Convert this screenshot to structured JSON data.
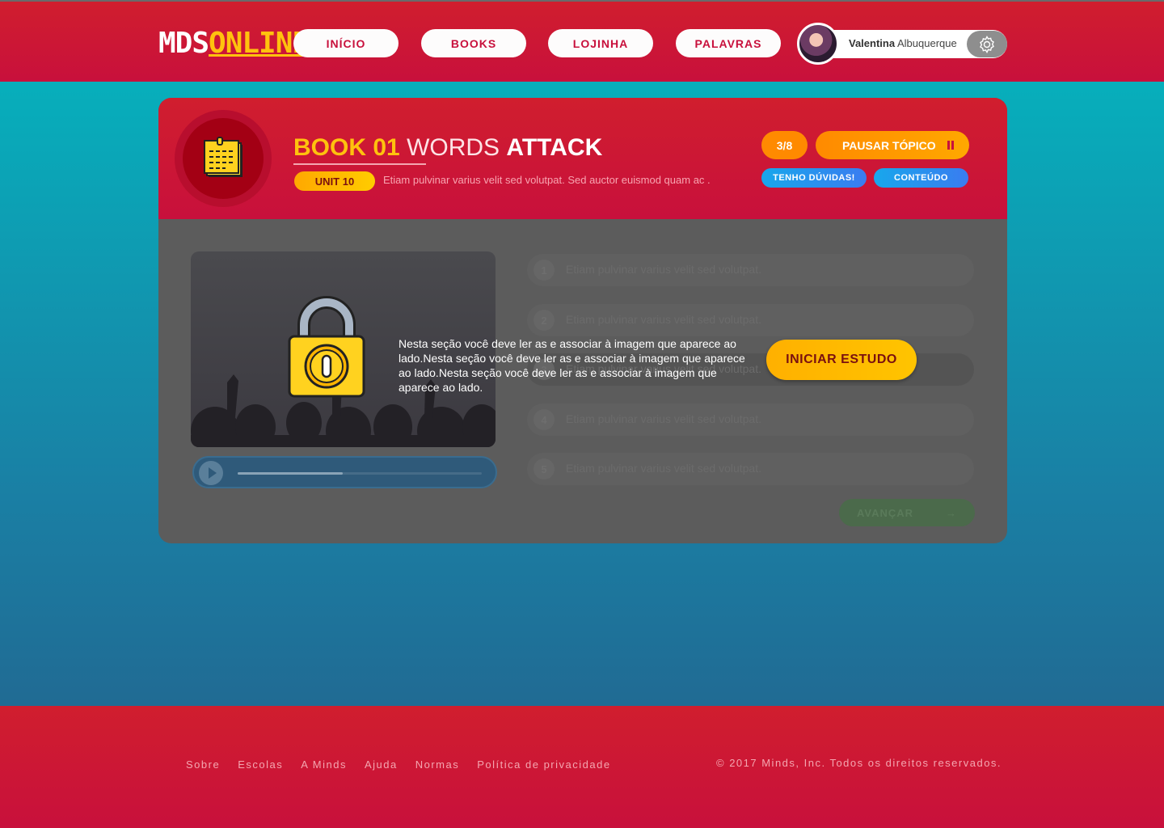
{
  "header": {
    "logo_part1": "MDS",
    "logo_part2": "ONLINE",
    "nav": [
      "INÍCIO",
      "BOOKS",
      "LOJINHA",
      "PALAVRAS"
    ],
    "user_first": "Valentina",
    "user_last": "Albuquerque"
  },
  "topic": {
    "book": "BOOK 01",
    "title_part1": "WORDS",
    "title_part2": "ATTACK",
    "unit": "UNIT 10",
    "unit_description": "Etiam pulvinar varius velit sed volutpat. Sed auctor euismod quam ac .",
    "progress": "3/8",
    "pause_label": "PAUSAR TÓPICO",
    "doubts_label": "TENHO DÚVIDAS!",
    "content_label": "CONTEÚDO"
  },
  "player": {
    "progress_fraction": 0.43
  },
  "questions": [
    {
      "number": "1",
      "text": "Etiam pulvinar varius velit sed volutpat."
    },
    {
      "number": "2",
      "text": "Etiam pulvinar varius velit sed volutpat."
    },
    {
      "number": "3",
      "text": "Etiam pulvinar varius velit sed volutpat."
    },
    {
      "number": "4",
      "text": "Etiam pulvinar varius velit sed volutpat."
    },
    {
      "number": "5",
      "text": "Etiam pulvinar varius velit sed volutpat."
    }
  ],
  "advance_label": "AVANÇAR",
  "advance_arrow": "→",
  "overlay": {
    "message": "Nesta seção você deve ler as   e associar à imagem que aparece ao lado.Nesta seção você deve ler as   e associar à imagem que aparece ao lado.Nesta seção você deve ler as   e associar à imagem que aparece ao lado.",
    "start_label": "INICIAR ESTUDO"
  },
  "footer": {
    "links": [
      "Sobre",
      "Escolas",
      "A Minds",
      "Ajuda",
      "Normas",
      "Política de privacidade"
    ],
    "copyright": "© 2017 Minds, Inc. Todos os direitos reservados."
  },
  "colors": {
    "brand_red": "#c8103c",
    "accent_yellow": "#ffc20e",
    "accent_orange": "#ff8a00",
    "accent_blue": "#18a7ec"
  }
}
